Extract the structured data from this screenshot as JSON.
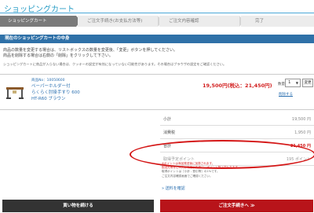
{
  "page_title": "ショッピングカート",
  "steps": [
    {
      "label": "ショッピングカート"
    },
    {
      "label": "ご注文手続き(お支払方法等)"
    },
    {
      "label": "ご注文内容確認"
    },
    {
      "label": "完了"
    }
  ],
  "section_header": "現在のショッピングカートの中身",
  "notes": {
    "line1": "商品の数量を変更する場合は、リストボックスの数量を変更後、「変更」ボタンを押してください。",
    "line2": "商品を削除する場合は右側の「削除」をクリックして下さい。",
    "line3": "ショッピングカートに商品が入らない場合は、クッキーの設定が有効になっていない可能性があります。その場合はブラウザの設定をご確認ください。"
  },
  "item": {
    "code": "商品No：10050600",
    "name_line1": "ペーパーホルダー付",
    "name_line2": "らくらく肘掛手すり 600",
    "name_line3": "HT-R60 ブラウン",
    "price": "19,500円(税込：21,450円)",
    "qty_label": "数量",
    "qty_value": "1",
    "change_label": "変更",
    "delete_label": "削除する"
  },
  "summary": {
    "subtotal_label": "小計",
    "subtotal_value": "19,500 円",
    "tax_label": "消費税",
    "tax_value": "1,950 円",
    "total_label": "合計",
    "total_value": "21,450 円",
    "points_label": "取得予定ポイント",
    "points_value": "195 ポイント"
  },
  "points_notes": {
    "line1": "※ポイントは商品発送後に加算されます。",
    "line2": "配送先等をご入力いただいた後に、ポイント数は変わります。",
    "line3": "取得ポイントは［小計 - 割引等］の1%です。",
    "line4": "ご注文内容確認画面でご確認ください。"
  },
  "shipping_link": "送料を確認",
  "buttons": {
    "continue": "買い物を続ける",
    "checkout": "ご注文手続きへ ≫"
  },
  "colors": {
    "accent_blue": "#2f71a8",
    "price_red": "#d21f1f",
    "checkout_red": "#b8141a",
    "annotation_red": "#d41616"
  }
}
